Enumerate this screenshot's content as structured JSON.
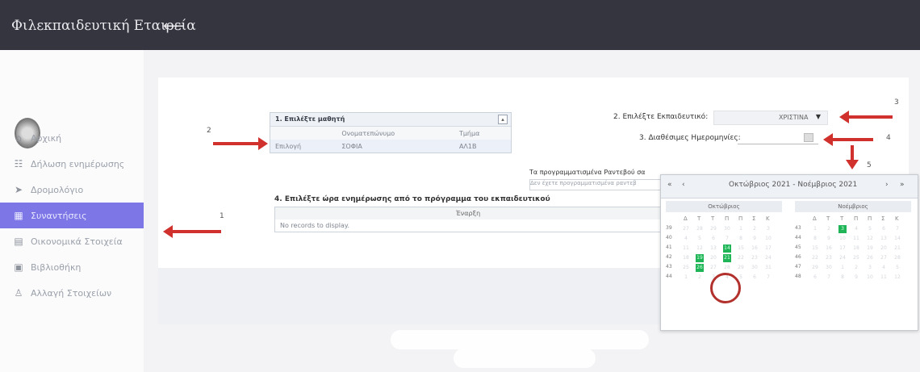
{
  "app": {
    "title": "Φιλεκπαιδευτική Εταιρεία",
    "menu_icon": "arrow-left-toggle-icon",
    "colors": {
      "topbar": "#35353f",
      "active": "#7c76e6",
      "accent_red": "#d0312d",
      "calendar_green": "#1fb557"
    }
  },
  "sidebar": {
    "items": [
      {
        "label": "Αρχική",
        "icon": "home-icon"
      },
      {
        "label": "Δήλωση ενημέρωσης",
        "icon": "chat-icon"
      },
      {
        "label": "Δρομολόγιο",
        "icon": "send-icon"
      },
      {
        "label": "Συναντήσεις",
        "icon": "grid-icon",
        "active": true
      },
      {
        "label": "Οικονομικά Στοιχεία",
        "icon": "money-icon"
      },
      {
        "label": "Βιβλιοθήκη",
        "icon": "book-icon"
      },
      {
        "label": "Αλλαγή Στοιχείων",
        "icon": "user-icon"
      }
    ]
  },
  "steps": {
    "student": {
      "title": "1. Επιλέξτε μαθητή",
      "headers": [
        "",
        "Ονοματεπώνυμο",
        "Τμήμα"
      ],
      "row": [
        "Επιλογή",
        "ΣΟΦΙΑ",
        "ΑΛ1Β"
      ]
    },
    "teacher": {
      "label": "2. Επιλέξτε Εκπαιδευτικό:",
      "value": "ΧΡΙΣΤΙΝΑ"
    },
    "available": {
      "label": "3. Διαθέσιμες Ημερομηνίες:"
    },
    "scheduled": {
      "title": "Τα προγραμματισμένα Ραντεβού σα",
      "empty": "Δεν έχετε προγραμματισμένα ραντεβ"
    },
    "hours": {
      "title": "4. Επιλέξτε ώρα ενημέρωσης από το πρόγραμμα του εκπαιδευτικού",
      "header": "Έναρξη",
      "empty": "No records to display."
    }
  },
  "annotations": [
    "1",
    "2",
    "3",
    "4",
    "5"
  ],
  "datepicker": {
    "title": "Οκτώβριος 2021 - Νοέμβριος 2021",
    "nav": [
      "«",
      "‹",
      "›",
      "»"
    ],
    "months": [
      {
        "name": "Οκτώβριος",
        "dow": [
          "Δ",
          "Τ",
          "Τ",
          "Π",
          "Π",
          "Σ",
          "Κ"
        ],
        "weeks": [
          "39",
          "40",
          "41",
          "42",
          "43",
          "44"
        ],
        "days": [
          [
            "27",
            "28",
            "29",
            "30",
            "1",
            "2",
            "3"
          ],
          [
            "4",
            "5",
            "6",
            "7",
            "8",
            "9",
            "10"
          ],
          [
            "11",
            "12",
            "13",
            "14",
            "15",
            "16",
            "17"
          ],
          [
            "18",
            "19",
            "20",
            "21",
            "22",
            "23",
            "24"
          ],
          [
            "25",
            "26",
            "27",
            "28",
            "29",
            "30",
            "31"
          ],
          [
            "1",
            "2",
            "3",
            "4",
            "5",
            "6",
            "7"
          ]
        ],
        "highlighted": [
          "2-3",
          "3-1",
          "3-3",
          "4-1"
        ]
      },
      {
        "name": "Νοέμβριος",
        "dow": [
          "Δ",
          "Τ",
          "Τ",
          "Π",
          "Π",
          "Σ",
          "Κ"
        ],
        "weeks": [
          "43",
          "44",
          "45",
          "46",
          "47",
          "48"
        ],
        "days": [
          [
            "1",
            "2",
            "3",
            "4",
            "5",
            "6",
            "7"
          ],
          [
            "8",
            "9",
            "10",
            "11",
            "12",
            "13",
            "14"
          ],
          [
            "15",
            "16",
            "17",
            "18",
            "19",
            "20",
            "21"
          ],
          [
            "22",
            "23",
            "24",
            "25",
            "26",
            "27",
            "28"
          ],
          [
            "29",
            "30",
            "1",
            "2",
            "3",
            "4",
            "5"
          ],
          [
            "6",
            "7",
            "8",
            "9",
            "10",
            "11",
            "12"
          ]
        ],
        "highlighted": [
          "0-2"
        ]
      }
    ]
  }
}
